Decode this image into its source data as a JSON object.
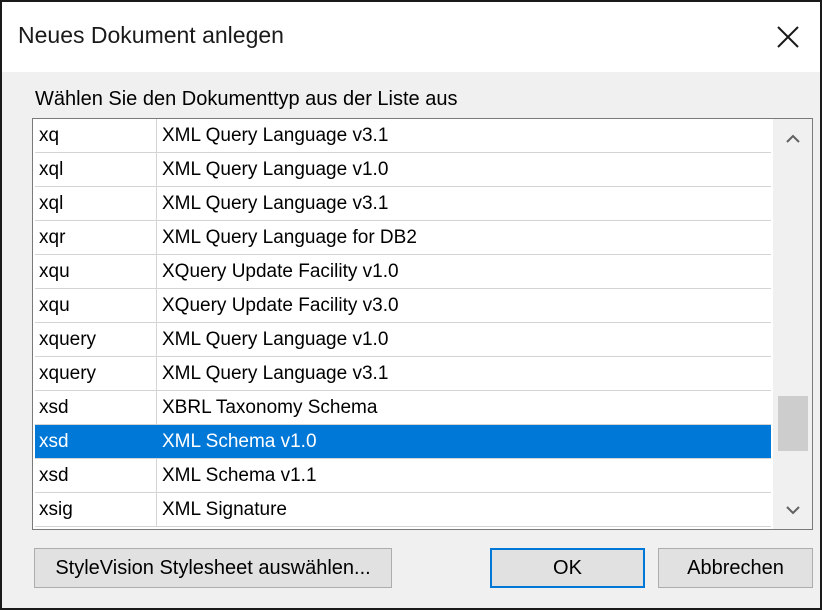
{
  "window": {
    "title": "Neues Dokument anlegen"
  },
  "prompt": "Wählen Sie den Dokumenttyp aus der Liste aus",
  "list": {
    "rows": [
      {
        "ext": "xq",
        "desc": "XML Query Language v3.1"
      },
      {
        "ext": "xql",
        "desc": "XML Query Language v1.0"
      },
      {
        "ext": "xql",
        "desc": "XML Query Language v3.1"
      },
      {
        "ext": "xqr",
        "desc": "XML Query Language for DB2"
      },
      {
        "ext": "xqu",
        "desc": "XQuery Update Facility v1.0"
      },
      {
        "ext": "xqu",
        "desc": "XQuery Update Facility v3.0"
      },
      {
        "ext": "xquery",
        "desc": "XML Query Language v1.0"
      },
      {
        "ext": "xquery",
        "desc": "XML Query Language v3.1"
      },
      {
        "ext": "xsd",
        "desc": "XBRL Taxonomy Schema"
      },
      {
        "ext": "xsd",
        "desc": "XML Schema v1.0"
      },
      {
        "ext": "xsd",
        "desc": "XML Schema v1.1"
      },
      {
        "ext": "xsig",
        "desc": "XML Signature"
      }
    ],
    "selected_index": 9
  },
  "buttons": {
    "stylesheet": "StyleVision Stylesheet auswählen...",
    "ok": "OK",
    "cancel": "Abbrechen"
  },
  "colors": {
    "selection": "#0078d7",
    "default_button_border": "#0078d7"
  },
  "icons": {
    "close": "close-icon",
    "scroll_up": "chevron-up-icon",
    "scroll_down": "chevron-down-icon"
  }
}
